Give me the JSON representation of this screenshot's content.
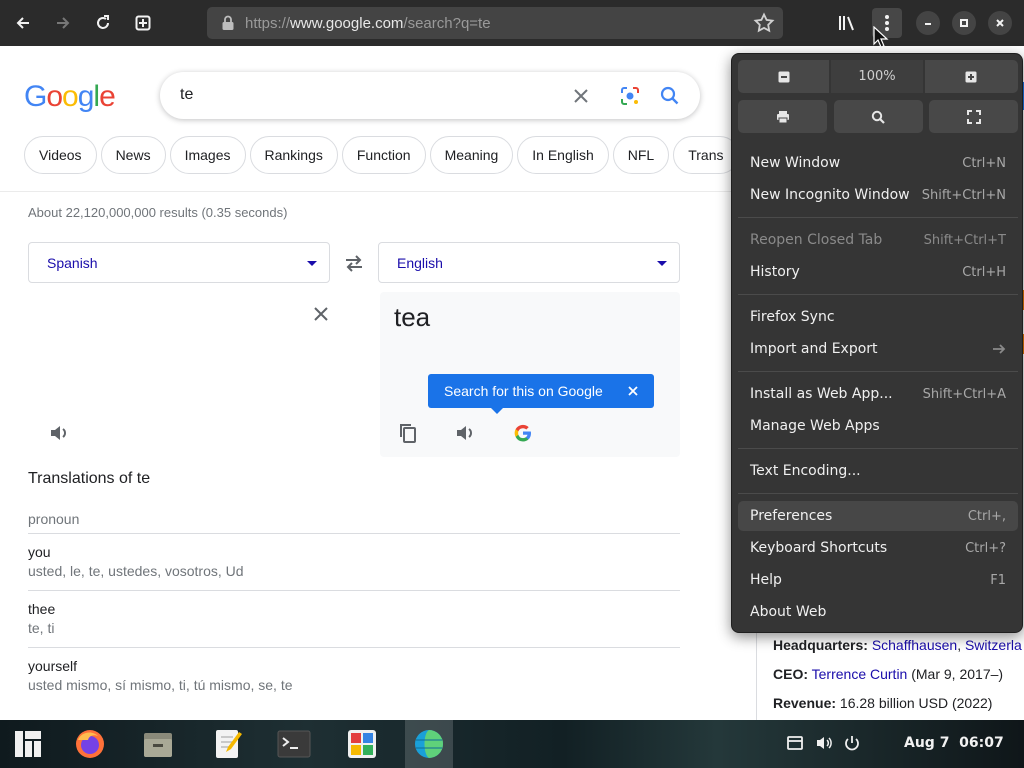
{
  "browser": {
    "url_prefix": "https://",
    "url_host": "www.google.com",
    "url_path": "/search?q=te"
  },
  "google": {
    "logo": {
      "G": "G",
      "o1": "o",
      "o2": "o",
      "g": "g",
      "l": "l",
      "e": "e"
    },
    "query": "te",
    "chips": [
      "Videos",
      "News",
      "Images",
      "Rankings",
      "Function",
      "Meaning",
      "In English",
      "NFL",
      "Trans"
    ],
    "result_stats": "About 22,120,000,000 results (0.35 seconds)",
    "translate": {
      "source_lang": "Spanish",
      "target_lang": "English",
      "translation": "tea",
      "tooltip": "Search for this on Google"
    },
    "translations_heading": "Translations of te",
    "part_of_speech": "pronoun",
    "rows": [
      {
        "word": "you",
        "synonyms": "usted, le, te, ustedes, vosotros, Ud"
      },
      {
        "word": "thee",
        "synonyms": "te, ti"
      },
      {
        "word": "yourself",
        "synonyms": "usted mismo, sí mismo, ti, tú mismo, se, te"
      }
    ],
    "knowledge_panel": {
      "hq_label": "Headquarters:",
      "hq_value1": "Schaffhausen",
      "hq_sep": ", ",
      "hq_value2": "Switzerla",
      "ceo_label": "CEO:",
      "ceo_value": "Terrence Curtin",
      "ceo_extra": " (Mar 9, 2017–)",
      "rev_label": "Revenue:",
      "rev_value": " 16.28 billion USD (2022)"
    }
  },
  "menu": {
    "zoom_level": "100%",
    "items": [
      {
        "label": "New Window",
        "accel": "Ctrl+N"
      },
      {
        "label": "New Incognito Window",
        "accel": "Shift+Ctrl+N"
      },
      {
        "label": "Reopen Closed Tab",
        "accel": "Shift+Ctrl+T"
      },
      {
        "label": "History",
        "accel": "Ctrl+H"
      },
      {
        "label": "Firefox Sync",
        "accel": ""
      },
      {
        "label": "Import and Export",
        "accel": ""
      },
      {
        "label": "Install as Web App...",
        "accel": "Shift+Ctrl+A"
      },
      {
        "label": "Manage Web Apps",
        "accel": ""
      },
      {
        "label": "Text Encoding...",
        "accel": ""
      },
      {
        "label": "Preferences",
        "accel": "Ctrl+,"
      },
      {
        "label": "Keyboard Shortcuts",
        "accel": "Ctrl+?"
      },
      {
        "label": "Help",
        "accel": "F1"
      },
      {
        "label": "About Web",
        "accel": ""
      }
    ]
  },
  "taskbar": {
    "clock": "Aug 7  06:07"
  },
  "colors": {
    "google_blue": "#4285f4",
    "google_red": "#ea4335",
    "google_yellow": "#fbbc05",
    "google_green": "#34a853",
    "link": "#1a0dab",
    "menu_bg": "#353535"
  }
}
